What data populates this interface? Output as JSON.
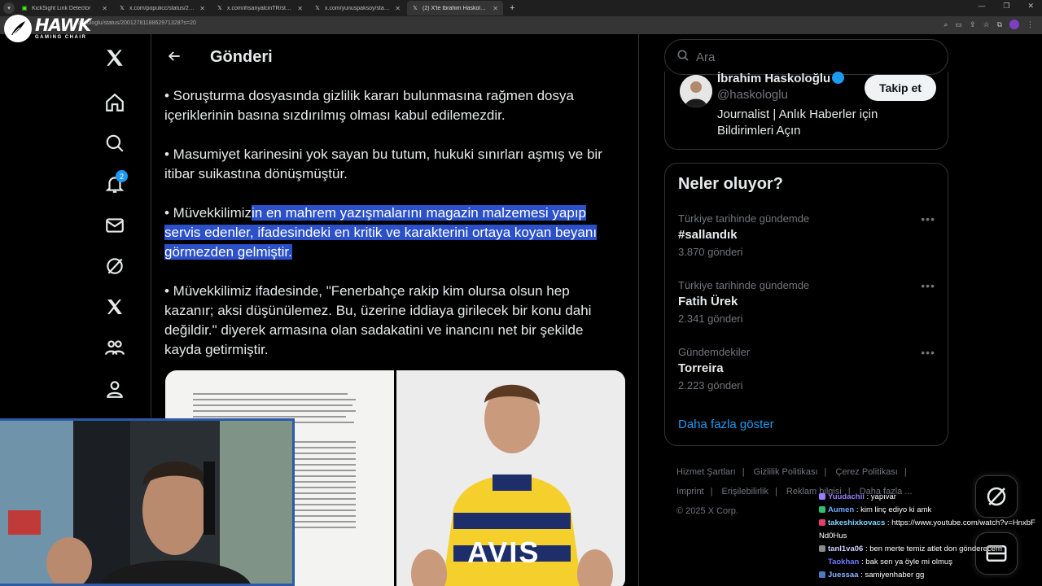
{
  "browser": {
    "tabs": [
      {
        "label": "KickSight Link Detector",
        "icon": "kick-favicon"
      },
      {
        "label": "x.com/populicc/status/20012...",
        "icon": "x-favicon"
      },
      {
        "label": "x.com/ihsanyalcinTR/status/20...",
        "icon": "x-favicon"
      },
      {
        "label": "x.com/yunuspaksoy/status/20...",
        "icon": "x-favicon"
      },
      {
        "label": "(2) X'te İbrahim Haskoloğlu: \"G...",
        "icon": "x-favicon",
        "active": true
      }
    ],
    "url": "askologlu/status/2001278118862971328?s=20"
  },
  "overlay_logo": {
    "brand": "HAWK",
    "subtitle": "GAMING CHAIR"
  },
  "nav": {
    "items": [
      "x-logo",
      "home",
      "explore",
      "notifications",
      "messages",
      "grok",
      "premium",
      "communities",
      "profile"
    ],
    "notification_count": "2"
  },
  "header": {
    "title": "Gönderi"
  },
  "post": {
    "p1": "• Soruşturma dosyasında gizlilik kararı bulunmasına rağmen dosya içeriklerinin basına sızdırılmış olması kabul edilemezdir.",
    "p2": "• Masumiyet karinesini yok sayan bu tutum, hukuki sınırları aşmış ve bir itibar suikastına dönüşmüştür.",
    "p3_pre": "• Müvekkilimiz",
    "p3_hl": "in en mahrem yazışmalarını magazin malzemesi yapıp servis edenler, ifadesindeki en kritik ve karakterini ortaya koyan beyanı görmezden gelmiştir. ",
    "p4": "• Müvekkilimiz ifadesinde, \"Fenerbahçe rakip kim olursa olsun hep kazanır; aksi düşünülemez. Bu, üzerine iddiaya girilecek bir konu dahi değildir.\" diyerek armasına olan sadakatini ve inancını net bir şekilde kayda getirmiştir.",
    "jersey_text": "AVIS"
  },
  "search": {
    "placeholder": "Ara"
  },
  "profile": {
    "name": "İbrahim Haskoloğlu",
    "handle": "@haskologlu",
    "bio": "Journalist | Anlık Haberler için Bildirimleri Açın",
    "follow_label": "Takip et"
  },
  "trends": {
    "title": "Neler oluyor?",
    "items": [
      {
        "context": "Türkiye tarihinde gündemde",
        "name": "#sallandık",
        "count": "3.870 gönderi"
      },
      {
        "context": "Türkiye tarihinde gündemde",
        "name": "Fatih Ürek",
        "count": "2.341 gönderi"
      },
      {
        "context": "Gündemdekiler",
        "name": "Torreira",
        "count": "2.223 gönderi"
      }
    ],
    "show_more": "Daha fazla göster"
  },
  "footer": {
    "links": [
      "Hizmet Şartları",
      "Gizlilik Politikası",
      "Çerez Politikası",
      "Imprint",
      "Erişilebilirlik",
      "Reklam bilgisi",
      "Daha fazla ..."
    ],
    "copyright": "© 2025 X Corp."
  },
  "chat": [
    {
      "user": "Yuudachii",
      "color": "#9b7dff",
      "badge": "#9b7dff",
      "msg": "yapıvar"
    },
    {
      "user": "Aumen",
      "color": "#6fa8ff",
      "badge": "#2fbf71",
      "msg": "kim linç ediyo ki amk"
    },
    {
      "user": "takeshixkovacs",
      "color": "#7fd3ff",
      "badge": "#e0406b",
      "msg": "https://www.youtube.com/watch?v=HnxbFNd0Hus"
    },
    {
      "user": "tanl1va06",
      "color": "#cfcfff",
      "badge": "#8a8a8a",
      "msg": "ben merte temiz atlet don gönderecem"
    },
    {
      "user": "Taokhan",
      "color": "#6f7dff",
      "badge": "",
      "msg": "bak sen ya öyle mi olmuş"
    },
    {
      "user": "Juessaa",
      "color": "#8ab4ff",
      "badge": "#4a7ac4",
      "msg": "samiyenhaber gg"
    }
  ],
  "colors": {
    "accent": "#1d9bf0",
    "highlight": "#2b50c8",
    "background": "#000000"
  }
}
